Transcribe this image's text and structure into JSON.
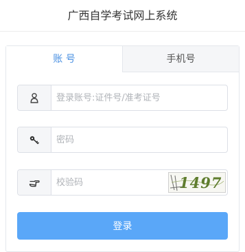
{
  "header": {
    "title": "广西自学考试网上系统"
  },
  "tabs": [
    {
      "label": "账 号",
      "active": true
    },
    {
      "label": "手机号",
      "active": false
    }
  ],
  "form": {
    "account_placeholder": "登录账号:证件号/准考证号",
    "password_placeholder": "密码",
    "captcha_placeholder": "校验码",
    "captcha_text": "1497",
    "login_label": "登录"
  },
  "icons": {
    "account": "user-icon",
    "password": "key-icon",
    "captcha": "pointing-hand-icon"
  },
  "colors": {
    "accent": "#4a90e2",
    "button": "#5aa7f8",
    "captcha_text": "#5f7d2e"
  }
}
